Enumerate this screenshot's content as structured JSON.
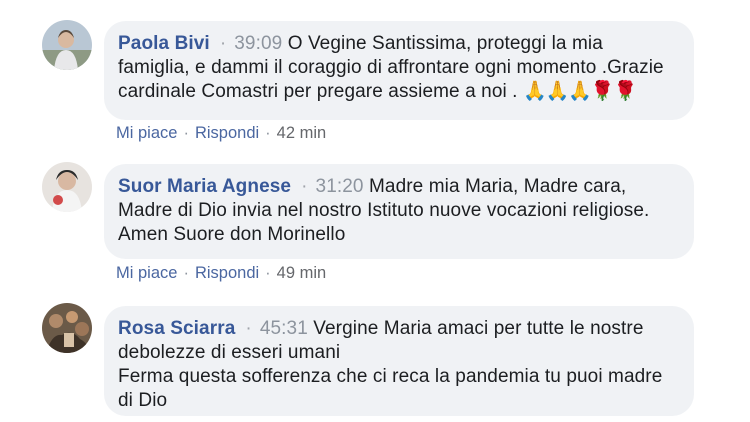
{
  "comments": [
    {
      "author": "Paola Bivi",
      "separator": "·",
      "timestamp": "39:09",
      "text_lines": [
        "O Vegine Santissima, proteggi la mia",
        "famiglia, e dammi il coraggio di affrontare ogni momento .Grazie",
        "cardinale Comastri per pregare assieme a noi . "
      ],
      "emoji": "🙏🙏🙏🌹🌹",
      "like_label": "Mi piace",
      "reply_label": "Rispondi",
      "dot": "·",
      "age": "42 min"
    },
    {
      "author": "Suor Maria Agnese",
      "separator": "·",
      "timestamp": "31:20",
      "text_lines": [
        "Madre mia Maria, Madre cara,",
        "Madre di Dio invia nel nostro Istituto nuove vocazioni religiose.",
        "Amen Suore don Morinello"
      ],
      "like_label": "Mi piace",
      "reply_label": "Rispondi",
      "dot": "·",
      "age": "49 min"
    },
    {
      "author": "Rosa Sciarra",
      "separator": "·",
      "timestamp": "45:31",
      "text_lines": [
        "Vergine Maria amaci per tutte le nostre",
        "debolezze di esseri umani",
        "Ferma questa sofferenza che ci reca la pandemia tu puoi madre",
        "di Dio"
      ]
    }
  ],
  "colors": {
    "author": "#385898",
    "bubble": "#f0f2f5",
    "action_link": "#4b67a1",
    "meta": "#8d949e"
  }
}
